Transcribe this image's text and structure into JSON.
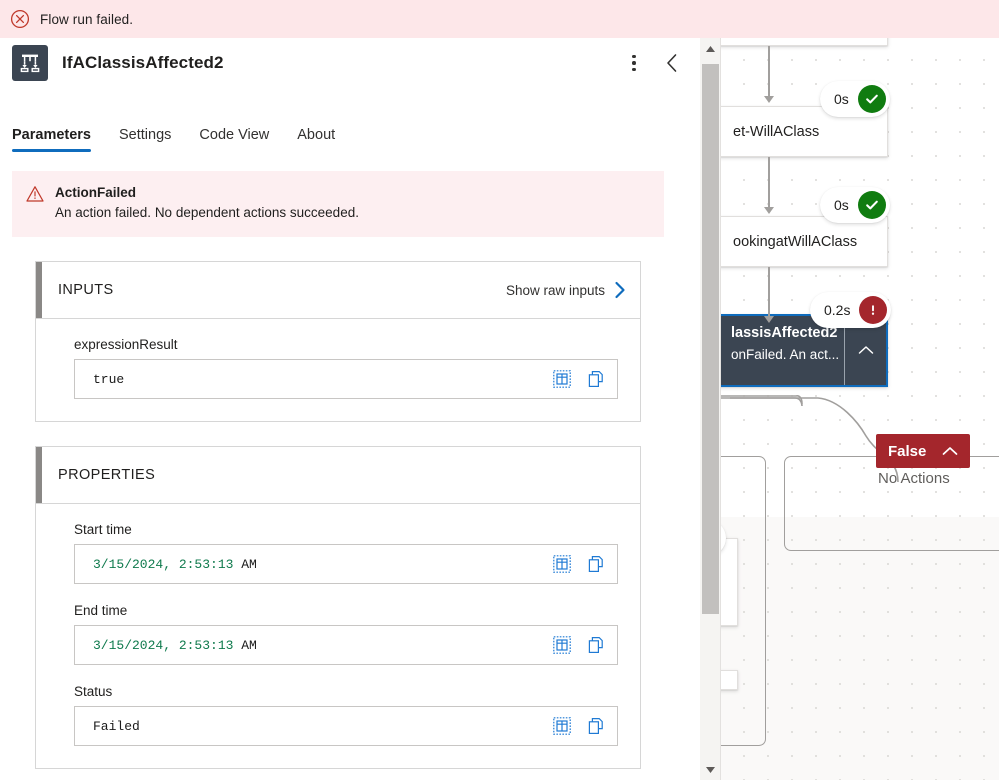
{
  "banner": {
    "icon": "error-circle-x-icon",
    "text": "Flow run failed."
  },
  "pane": {
    "icon": "condition-branch-icon",
    "title": "IfAClassisAffected2",
    "more_menu": "more-options-icon",
    "collapse": "chevron-left-icon",
    "tabs": [
      {
        "label": "Parameters",
        "active": true
      },
      {
        "label": "Settings",
        "active": false
      },
      {
        "label": "Code View",
        "active": false
      },
      {
        "label": "About",
        "active": false
      }
    ],
    "error": {
      "icon": "warning-triangle-icon",
      "title": "ActionFailed",
      "message": "An action failed. No dependent actions succeeded."
    },
    "inputs_section": {
      "title": "INPUTS",
      "raw_link": "Show raw inputs",
      "raw_link_icon": "chevron-right-icon",
      "fields": [
        {
          "label": "expressionResult",
          "value": "true",
          "value_is_datetime": false,
          "expand_icon": "expand-table-icon",
          "copy_icon": "copy-icon"
        }
      ]
    },
    "properties_section": {
      "title": "PROPERTIES",
      "fields": [
        {
          "label": "Start time",
          "value_date": "3/15/2024, 2:53:13",
          "value_suffix": " AM",
          "value_is_datetime": true,
          "expand_icon": "expand-table-icon",
          "copy_icon": "copy-icon"
        },
        {
          "label": "End time",
          "value_date": "3/15/2024, 2:53:13",
          "value_suffix": " AM",
          "value_is_datetime": true,
          "expand_icon": "expand-table-icon",
          "copy_icon": "copy-icon"
        },
        {
          "label": "Status",
          "value_date": "",
          "value_suffix": "Failed",
          "value_is_datetime": false,
          "expand_icon": "expand-table-icon",
          "copy_icon": "copy-icon"
        }
      ]
    }
  },
  "canvas": {
    "nodes": [
      {
        "label": "",
        "duration": "",
        "status": ""
      },
      {
        "label": "et-WillAClass",
        "duration": "0s",
        "status": "succeeded"
      },
      {
        "label": "ookingatWillAClass",
        "duration": "0s",
        "status": "succeeded"
      }
    ],
    "selected_node": {
      "title": "lassisAffected2",
      "subtitle": "onFailed. An act...",
      "duration": "0.2s",
      "status": "failed",
      "collapse_icon": "chevron-up-icon"
    },
    "false_branch": {
      "label": "False",
      "chevron_icon": "chevron-up-icon",
      "empty_text": "No Actions"
    }
  },
  "scrollbar": {
    "up_icon": "scroll-up-arrow-icon",
    "down_icon": "scroll-down-arrow-icon",
    "thumb": "scroll-thumb"
  },
  "colors": {
    "error_red": "#a4262c",
    "banner_pink": "#fde7e9",
    "accent_blue": "#0f6cbd",
    "success_green": "#107c10",
    "node_dark": "#3b4552",
    "datetime_green": "#0f7a4d"
  }
}
